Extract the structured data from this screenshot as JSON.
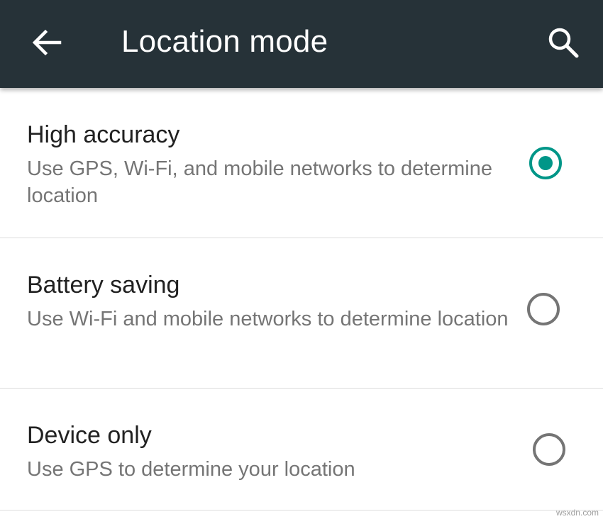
{
  "app_bar": {
    "title": "Location mode",
    "back_icon": "arrow-back-icon",
    "search_icon": "search-icon",
    "background_color": "#263238"
  },
  "options": [
    {
      "title": "High accuracy",
      "summary": "Use GPS, Wi-Fi, and mobile networks to determine location",
      "selected": true
    },
    {
      "title": "Battery saving",
      "summary": "Use Wi-Fi and mobile networks to determine location",
      "selected": false
    },
    {
      "title": "Device only",
      "summary": "Use GPS to determine your location",
      "selected": false
    }
  ],
  "accent_color": "#009688",
  "watermark": "wsxdn.com"
}
